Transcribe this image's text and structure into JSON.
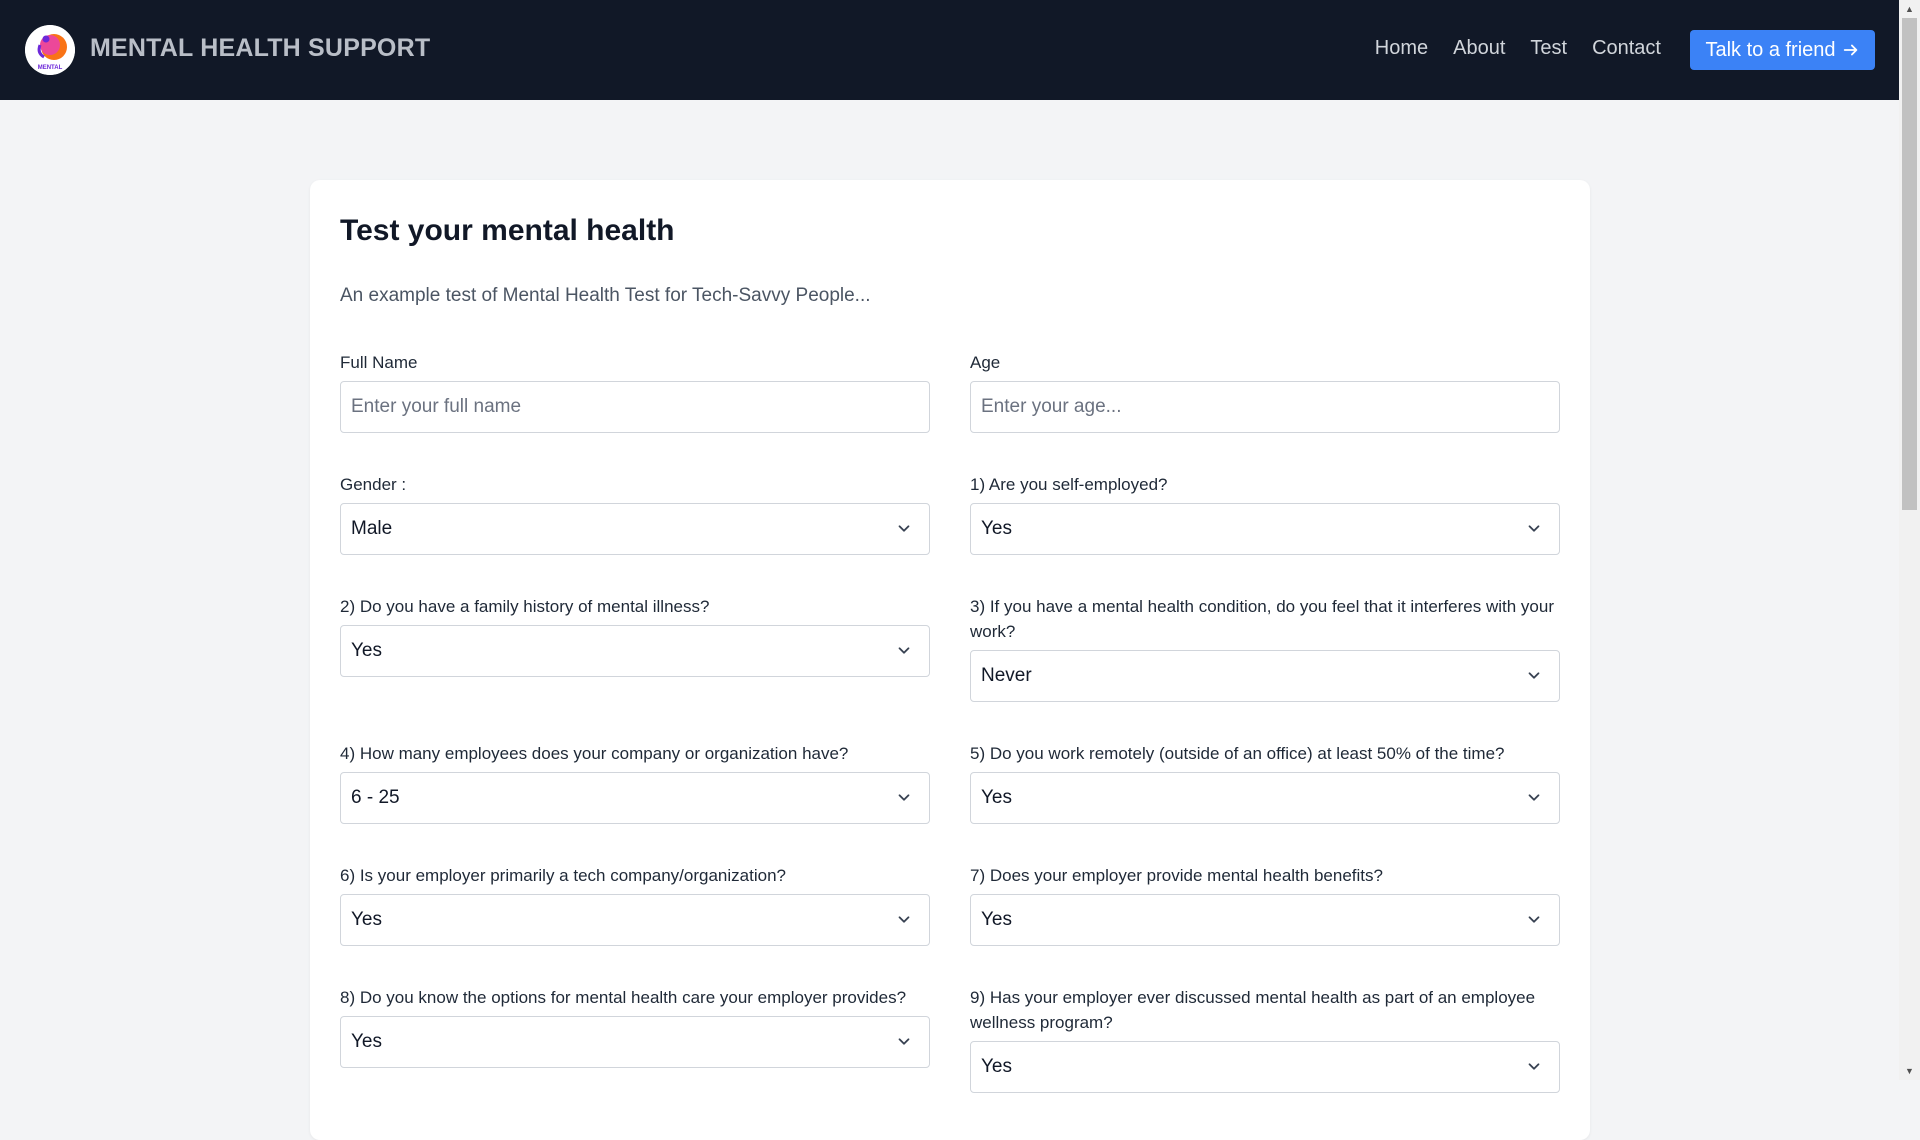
{
  "brand": {
    "name": "MENTAL HEALTH SUPPORT",
    "logo_text": "MENTAL"
  },
  "nav": {
    "links": [
      "Home",
      "About",
      "Test",
      "Contact"
    ],
    "cta_label": "Talk to a friend"
  },
  "colors": {
    "navbar_bg": "#111827",
    "accent": "#3b82f6",
    "page_bg": "#f3f4f6"
  },
  "form": {
    "title": "Test your mental health",
    "subtitle": "An example test of Mental Health Test for Tech-Savvy People...",
    "full_name": {
      "label": "Full Name",
      "placeholder": "Enter your full name"
    },
    "age": {
      "label": "Age",
      "placeholder": "Enter your age..."
    },
    "gender": {
      "label": "Gender :",
      "value": "Male"
    },
    "q1": {
      "label": "1) Are you self-employed?",
      "value": "Yes"
    },
    "q2": {
      "label": "2) Do you have a family history of mental illness?",
      "value": "Yes"
    },
    "q3": {
      "label": "3) If you have a mental health condition, do you feel that it interferes with your work?",
      "value": "Never"
    },
    "q4": {
      "label": "4) How many employees does your company or organization have?",
      "value": "6 - 25"
    },
    "q5": {
      "label": "5) Do you work remotely (outside of an office) at least 50% of the time?",
      "value": "Yes"
    },
    "q6": {
      "label": "6) Is your employer primarily a tech company/organization?",
      "value": "Yes"
    },
    "q7": {
      "label": "7) Does your employer provide mental health benefits?",
      "value": "Yes"
    },
    "q8": {
      "label": "8) Do you know the options for mental health care your employer provides?",
      "value": "Yes"
    },
    "q9": {
      "label": "9) Has your employer ever discussed mental health as part of an employee wellness program?",
      "value": "Yes"
    }
  }
}
